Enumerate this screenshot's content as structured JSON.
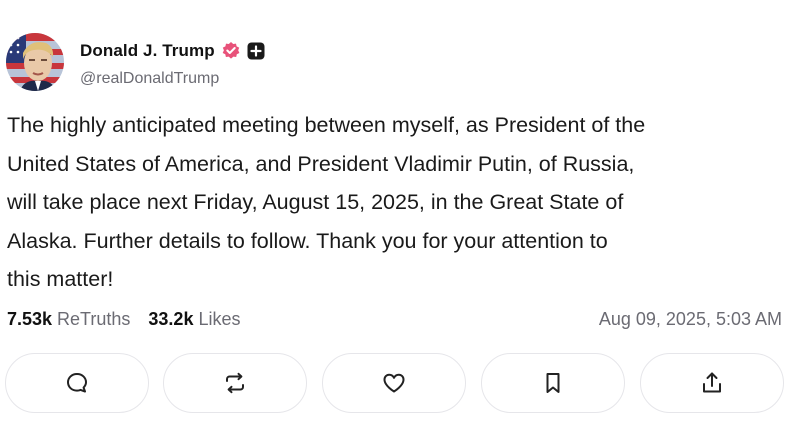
{
  "author": {
    "display_name": "Donald J. Trump",
    "handle": "@realDonaldTrump",
    "avatar_icon": "avatar-portrait-flag",
    "verified_icon": "verified-badge-icon",
    "extra_badge_icon": "plus-badge-icon",
    "verified_color": "#e8527a"
  },
  "post": {
    "text": "The highly anticipated meeting between myself, as President of the\nUnited States of America, and President Vladimir Putin, of Russia,\nwill take place next Friday, August 15, 2025, in the Great State of\nAlaska. Further details to follow. Thank you for your attention to\nthis matter!"
  },
  "stats": {
    "retruths_value": "7.53k",
    "retruths_label": "ReTruths",
    "likes_value": "33.2k",
    "likes_label": "Likes",
    "timestamp": "Aug 09, 2025, 5:03 AM"
  },
  "actions": [
    {
      "icon": "reply-icon"
    },
    {
      "icon": "retruth-icon"
    },
    {
      "icon": "like-icon"
    },
    {
      "icon": "bookmark-icon"
    },
    {
      "icon": "share-icon"
    }
  ]
}
